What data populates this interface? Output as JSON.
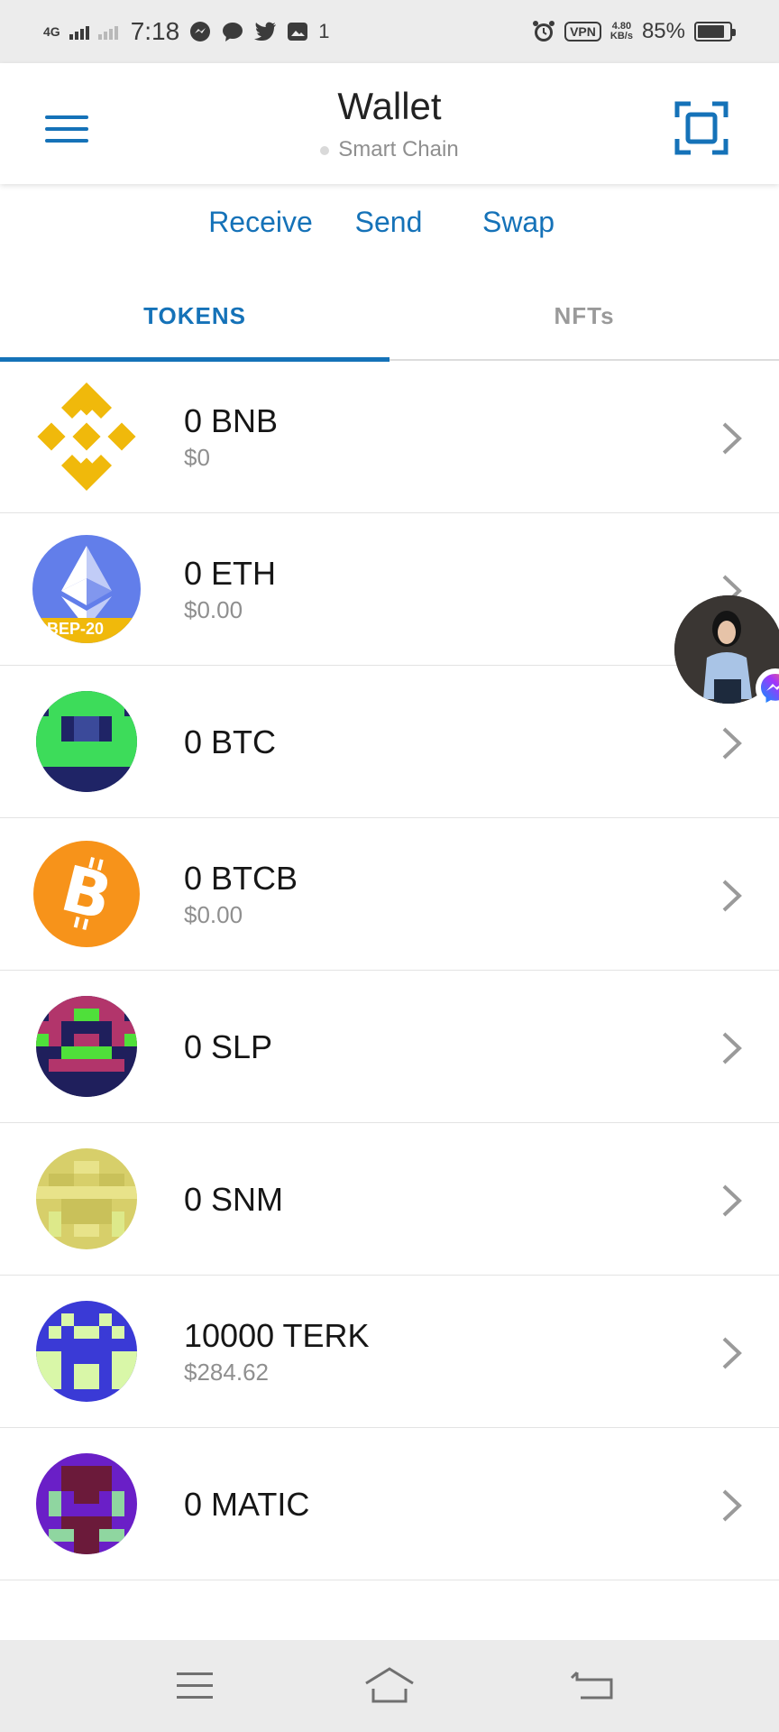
{
  "status_bar": {
    "network": "4G",
    "time": "7:18",
    "notification_count": "1",
    "vpn": "VPN",
    "speed_value": "4.80",
    "speed_unit": "KB/s",
    "battery_percent": "85%",
    "battery_level": 0.85
  },
  "header": {
    "title": "Wallet",
    "subtitle": "Smart Chain"
  },
  "actions": [
    {
      "label": "Receive"
    },
    {
      "label": "Send"
    },
    {
      "label": "Swap"
    }
  ],
  "tabs": [
    {
      "label": "TOKENS",
      "active": true
    },
    {
      "label": "NFTs",
      "active": false
    }
  ],
  "tokens": [
    {
      "amount": "0 BNB",
      "fiat": "$0",
      "icon": "bnb-logo-icon"
    },
    {
      "amount": "0 ETH",
      "fiat": "$0.00",
      "icon": "eth-logo-icon",
      "badge": "BEP-20"
    },
    {
      "amount": "0 BTC",
      "fiat": "",
      "icon": "btc-identicon-icon"
    },
    {
      "amount": "0 BTCB",
      "fiat": "$0.00",
      "icon": "bitcoin-logo-icon"
    },
    {
      "amount": "0 SLP",
      "fiat": "",
      "icon": "slp-identicon-icon"
    },
    {
      "amount": "0 SNM",
      "fiat": "",
      "icon": "snm-identicon-icon"
    },
    {
      "amount": "10000 TERK",
      "fiat": "$284.62",
      "icon": "terk-identicon-icon"
    },
    {
      "amount": "0 MATIC",
      "fiat": "",
      "icon": "matic-identicon-icon"
    }
  ],
  "colors": {
    "accent": "#1572b8",
    "bnb_yellow": "#f0b90b",
    "eth_blue": "#627eea",
    "btc_orange": "#f7931a"
  },
  "nav_bar": {
    "items": [
      "menu-icon",
      "home-icon",
      "back-icon"
    ]
  }
}
